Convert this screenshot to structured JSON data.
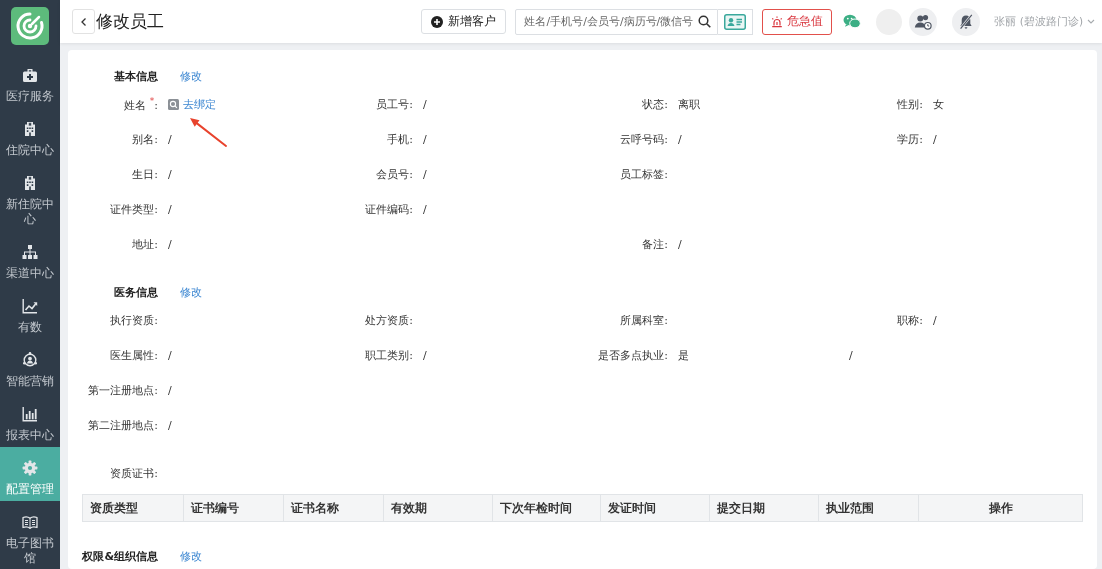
{
  "sidebar": {
    "items": [
      {
        "label": "医疗服务",
        "selected": false
      },
      {
        "label": "住院中心",
        "selected": false
      },
      {
        "label": "新住院中心",
        "selected": false
      },
      {
        "label": "渠道中心",
        "selected": false
      },
      {
        "label": "有数",
        "selected": false
      },
      {
        "label": "智能营销",
        "selected": false
      },
      {
        "label": "报表中心",
        "selected": false
      },
      {
        "label": "配置管理",
        "selected": true
      },
      {
        "label": "电子图书馆",
        "selected": false
      }
    ]
  },
  "header": {
    "title": "修改员工",
    "add_button": "新增客户",
    "search": {
      "placeholder": "姓名/手机号/会员号/病历号/微信号"
    },
    "alert_button": "危急值",
    "user": "张丽 (碧波路门诊)"
  },
  "sections": [
    {
      "title": "基本信息",
      "action": "修改",
      "rows": [
        [
          {
            "kind": "link",
            "label": "姓名 $^{*}$:",
            "value": "去绑定"
          },
          {
            "kind": "text",
            "label": "员工号:",
            "value": "/"
          },
          {
            "kind": "text",
            "label": "状态:",
            "value": "离职"
          },
          {
            "kind": "text",
            "label": "性别:",
            "value": "女"
          }
        ],
        [
          {
            "kind": "text",
            "label": "别名:",
            "value": "/"
          },
          {
            "kind": "text",
            "label": "手机:",
            "value": "/"
          },
          {
            "kind": "text",
            "label": "云呼号码:",
            "value": "/"
          },
          {
            "kind": "text",
            "label": "学历:",
            "value": "/"
          }
        ],
        [
          {
            "kind": "text",
            "label": "生日:",
            "value": "/"
          },
          {
            "kind": "text",
            "label": "会员号:",
            "value": "/"
          },
          {
            "kind": "text",
            "label": "员工标签:"
          }
        ],
        [
          {
            "kind": "text",
            "label": "证件类型:",
            "value": "/"
          },
          {
            "kind": "text",
            "label": "证件编码:",
            "value": "/"
          }
        ],
        [
          {
            "kind": "text",
            "label": "地址:",
            "value": "/"
          },
          "",
          {
            "kind": "text",
            "label": "备注:",
            "value": "/"
          }
        ]
      ]
    },
    {
      "title": "医务信息",
      "action": "修改",
      "rows": [
        [
          {
            "kind": "text",
            "label": "执行资质:"
          },
          {
            "kind": "text",
            "label": "处方资质:"
          },
          {
            "kind": "text",
            "label": "所属科室:"
          },
          {
            "kind": "text",
            "label": "职称:",
            "value": "/"
          }
        ],
        [
          {
            "kind": "text",
            "label": "医生属性:",
            "value": "/"
          },
          {
            "kind": "text",
            "label": "职工类别:",
            "value": "/"
          },
          {
            "kind": "text",
            "label": "是否多点执业:",
            "value": "是",
            "detail": "/"
          }
        ],
        [
          {
            "kind": "text",
            "label": "第一注册地点:",
            "value": "/"
          }
        ],
        [
          {
            "kind": "text",
            "label": "第二注册地点:",
            "value": "/"
          }
        ]
      ],
      "certificates": {
        "label": "资质证书:",
        "columns": [
          "资质类型",
          "证书编号",
          "证书名称",
          "有效期",
          "下次年检时间",
          "发证时间",
          "提交日期",
          "执业范围",
          "操作"
        ]
      }
    },
    {
      "title": "权限&组织信息",
      "action": "修改"
    }
  ]
}
